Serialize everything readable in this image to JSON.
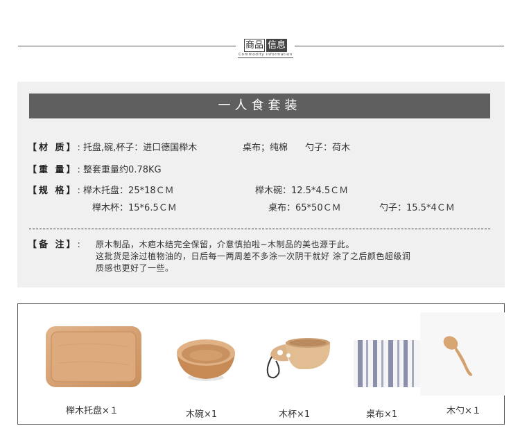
{
  "header": {
    "title_plain": "商品",
    "title_inverted": "信息",
    "subtitle": "Commodity information"
  },
  "banner": {
    "title": "一人食套装"
  },
  "specs": {
    "material_label": "【材 质】",
    "material_value": ": 托盘,碗,杯子：进口德国榉木",
    "material_cloth": "桌布；纯棉",
    "material_spoon": "勺子：荷木",
    "weight_label": "【重 量】",
    "weight_value": ": 整套重量约0.78KG",
    "size_label": "【规 格】",
    "size_tray": ": 榉木托盘：25*18ＣＭ",
    "size_bowl": "榉木碗：12.5*4.5ＣＭ",
    "size_cup": "榉木杯：15*6.5ＣＭ",
    "size_cloth": "桌布：65*50ＣＭ",
    "size_spoon": "勺子：15.5*4ＣＭ"
  },
  "notes": {
    "label": "【备 注】",
    "colon": ":",
    "line1": "原木制品，木疤木结完全保留，介意慎拍啦~木制品的美也源于此。",
    "line2": "这批货是涂过植物油的，日后每一两周差不多涂一次阴干就好   涂了之后颜色超级润",
    "line3": "质感也更好了一些。"
  },
  "products": [
    {
      "name": "榉木托盘×１",
      "icon": "wooden-tray-icon"
    },
    {
      "name": "木碗×1",
      "icon": "wooden-bowl-icon"
    },
    {
      "name": "木杯×1",
      "icon": "wooden-cup-icon"
    },
    {
      "name": "桌布×1",
      "icon": "table-cloth-icon"
    },
    {
      "name": "木勺×１",
      "icon": "wooden-spoon-icon"
    }
  ],
  "colors": {
    "banner_bg": "#5f5f5f",
    "panel_bg": "#f0f0f0",
    "wood": "#d9a77a"
  }
}
